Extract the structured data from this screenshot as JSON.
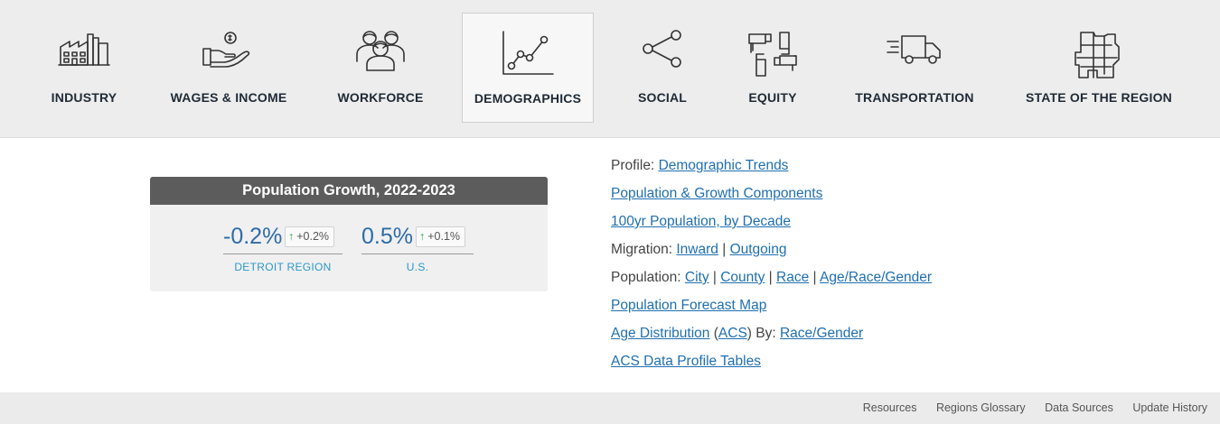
{
  "nav": {
    "items": [
      {
        "label": "INDUSTRY",
        "icon": "factory-icon"
      },
      {
        "label": "WAGES & INCOME",
        "icon": "hand-coin-icon"
      },
      {
        "label": "WORKFORCE",
        "icon": "people-group-icon"
      },
      {
        "label": "DEMOGRAPHICS",
        "icon": "line-chart-icon",
        "active": true
      },
      {
        "label": "SOCIAL",
        "icon": "share-icon"
      },
      {
        "label": "EQUITY",
        "icon": "linked-hands-icon"
      },
      {
        "label": "TRANSPORTATION",
        "icon": "truck-icon"
      },
      {
        "label": "STATE OF THE REGION",
        "icon": "region-map-icon"
      }
    ]
  },
  "card": {
    "title": "Population Growth, 2022-2023",
    "stats": [
      {
        "value": "-0.2%",
        "change": "+0.2%",
        "label": "DETROIT REGION"
      },
      {
        "value": "0.5%",
        "change": "+0.1%",
        "label": "U.S."
      }
    ]
  },
  "links": {
    "profile_prefix": "Profile:",
    "demographic_trends": "Demographic Trends",
    "population_growth": "Population & Growth Components",
    "population_100yr": "100yr Population, by Decade",
    "migration_prefix": "Migration:",
    "inward": "Inward",
    "outgoing": "Outgoing",
    "population_prefix": "Population:",
    "city": "City",
    "county": "County",
    "race": "Race",
    "age_race_gender": "Age/Race/Gender",
    "forecast_map": "Population Forecast Map",
    "age_distribution": "Age Distribution",
    "acs": "ACS",
    "by_text": "By:",
    "race_gender": "Race/Gender",
    "acs_tables": "ACS Data Profile Tables",
    "separator": "|"
  },
  "footer": {
    "links": [
      "Resources",
      "Regions Glossary",
      "Data Sources",
      "Update History"
    ]
  },
  "colors": {
    "accent": "#2d6ca8",
    "link": "#1f6fb0",
    "label": "#2a97c9",
    "up": "#28a745",
    "header_bg": "#5c5c5c"
  }
}
